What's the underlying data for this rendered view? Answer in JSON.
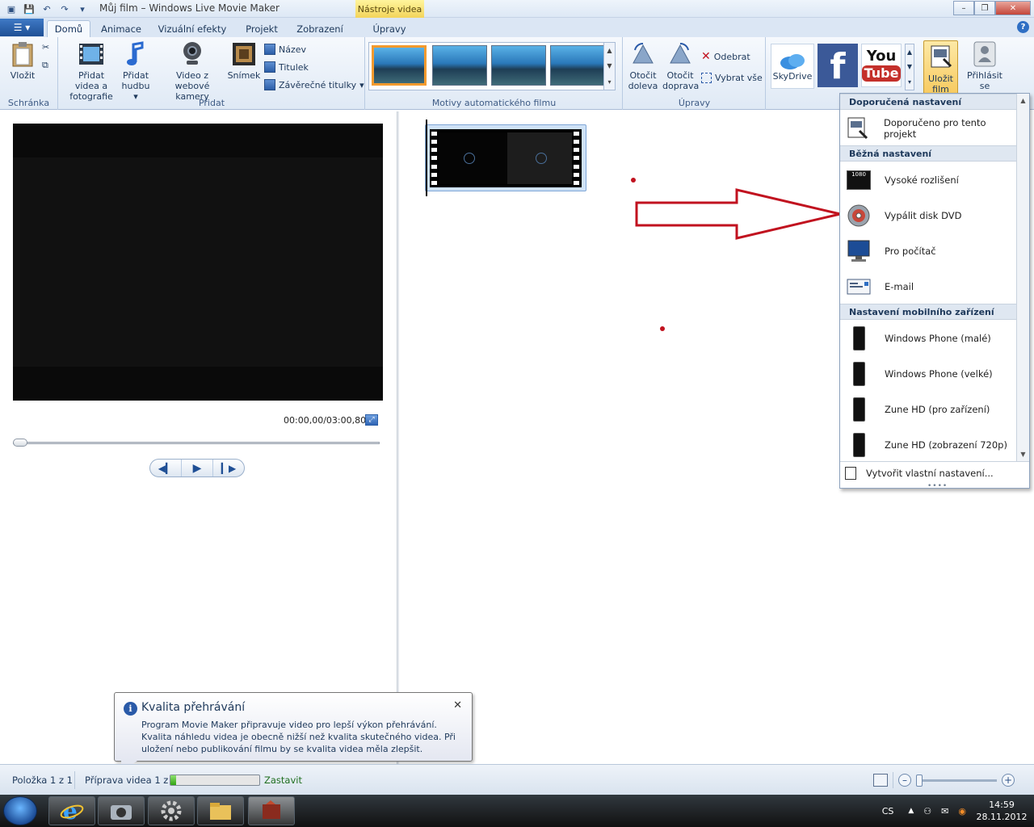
{
  "window": {
    "title": "Můj film – Windows Live Movie Maker",
    "contextual_tab": "Nástroje videa"
  },
  "tabs": [
    "Domů",
    "Animace",
    "Vizuální efekty",
    "Projekt",
    "Zobrazení",
    "Úpravy"
  ],
  "ribbon": {
    "clipboard": {
      "paste": "Vložit",
      "group": "Schránka"
    },
    "add": {
      "add_video": "Přidat videa a fotografie",
      "add_music": "Přidat hudbu",
      "webcam": "Video z webové kamery",
      "snapshot": "Snímek",
      "title": "Název",
      "caption": "Titulek",
      "credits": "Závěrečné titulky",
      "group": "Přidat"
    },
    "themes_group": "Motivy automatického filmu",
    "editing": {
      "rotate_left": "Otočit doleva",
      "rotate_right": "Otočit doprava",
      "remove": "Odebrat",
      "select_all": "Vybrat vše",
      "group": "Úpravy"
    },
    "share": {
      "skydrive": "SkyDrive",
      "youtube_you": "You",
      "youtube_tube": "Tube",
      "facebook_f": "f",
      "save_movie": "Uložit film",
      "sign_in": "Přihlásit se"
    }
  },
  "player": {
    "timecode": "00:00,00/03:00,80"
  },
  "save_menu": {
    "section_recommended": "Doporučená nastavení",
    "recommended_item": "Doporučeno pro tento projekt",
    "section_common": "Běžná nastavení",
    "common_items": [
      "Vysoké rozlišení",
      "Vypálit disk DVD",
      "Pro počítač",
      "E-mail"
    ],
    "section_mobile": "Nastavení mobilního zařízení",
    "mobile_items": [
      "Windows Phone (malé)",
      "Windows Phone (velké)",
      "Zune HD (pro zařízení)",
      "Zune HD (zobrazení 720p)"
    ],
    "custom": "Vytvořit vlastní nastavení...",
    "hd_badge": "1080"
  },
  "tooltip": {
    "title": "Kvalita přehrávání",
    "body": "Program Movie Maker připravuje video pro lepší výkon přehrávání. Kvalita náhledu videa je obecně nižší než kvalita skutečného videa. Při uložení nebo publikování filmu by se kvalita videa měla zlepšit."
  },
  "statusbar": {
    "item": "Položka 1 z 1",
    "preparing": "Příprava videa 1 z 1",
    "progress": 0.06,
    "stop": "Zastavit"
  },
  "taskbar": {
    "lang": "CS",
    "time": "14:59",
    "date": "28.11.2012"
  },
  "colors": {
    "annotation_red": "#c1121f",
    "accent_blue": "#1e395b",
    "save_highlight": "#f6c350"
  }
}
